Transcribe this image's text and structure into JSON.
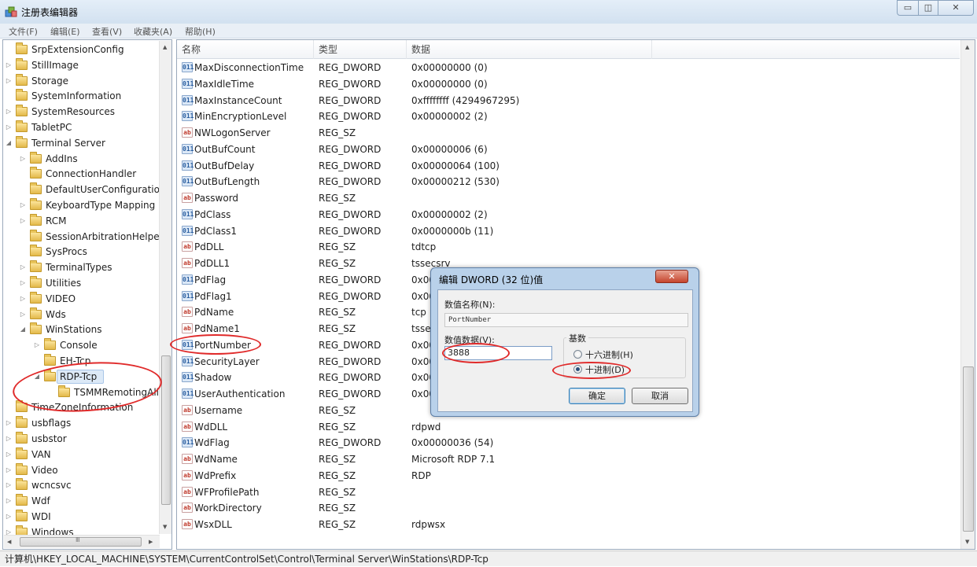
{
  "window": {
    "title": "注册表编辑器",
    "controls": {
      "minimize": "▭",
      "maximize": "◫",
      "close": "✕"
    }
  },
  "menu": [
    "文件(F)",
    "编辑(E)",
    "查看(V)",
    "收藏夹(A)",
    "帮助(H)"
  ],
  "tree": {
    "nodes": [
      {
        "label": "SrpExtensionConfig",
        "level": 0,
        "expander": "none"
      },
      {
        "label": "StillImage",
        "level": 0,
        "expander": "collapsed"
      },
      {
        "label": "Storage",
        "level": 0,
        "expander": "collapsed"
      },
      {
        "label": "SystemInformation",
        "level": 0,
        "expander": "none"
      },
      {
        "label": "SystemResources",
        "level": 0,
        "expander": "collapsed"
      },
      {
        "label": "TabletPC",
        "level": 0,
        "expander": "collapsed"
      },
      {
        "label": "Terminal Server",
        "level": 0,
        "expander": "expanded"
      },
      {
        "label": "AddIns",
        "level": 1,
        "expander": "collapsed"
      },
      {
        "label": "ConnectionHandler",
        "level": 1,
        "expander": "none"
      },
      {
        "label": "DefaultUserConfiguratior",
        "level": 1,
        "expander": "none"
      },
      {
        "label": "KeyboardType Mapping",
        "level": 1,
        "expander": "collapsed"
      },
      {
        "label": "RCM",
        "level": 1,
        "expander": "collapsed"
      },
      {
        "label": "SessionArbitrationHelper",
        "level": 1,
        "expander": "none"
      },
      {
        "label": "SysProcs",
        "level": 1,
        "expander": "none"
      },
      {
        "label": "TerminalTypes",
        "level": 1,
        "expander": "collapsed"
      },
      {
        "label": "Utilities",
        "level": 1,
        "expander": "collapsed"
      },
      {
        "label": "VIDEO",
        "level": 1,
        "expander": "collapsed"
      },
      {
        "label": "Wds",
        "level": 1,
        "expander": "collapsed"
      },
      {
        "label": "WinStations",
        "level": 1,
        "expander": "expanded"
      },
      {
        "label": "Console",
        "level": 2,
        "expander": "collapsed"
      },
      {
        "label": "EH-Tcp",
        "level": 2,
        "expander": "none"
      },
      {
        "label": "RDP-Tcp",
        "level": 2,
        "expander": "expanded",
        "selected": true
      },
      {
        "label": "TSMMRemotingAll",
        "level": 3,
        "expander": "none"
      },
      {
        "label": "TimeZoneInformation",
        "level": 0,
        "expander": "none"
      },
      {
        "label": "usbflags",
        "level": 0,
        "expander": "collapsed"
      },
      {
        "label": "usbstor",
        "level": 0,
        "expander": "collapsed"
      },
      {
        "label": "VAN",
        "level": 0,
        "expander": "collapsed"
      },
      {
        "label": "Video",
        "level": 0,
        "expander": "collapsed"
      },
      {
        "label": "wcncsvc",
        "level": 0,
        "expander": "collapsed"
      },
      {
        "label": "Wdf",
        "level": 0,
        "expander": "collapsed"
      },
      {
        "label": "WDI",
        "level": 0,
        "expander": "collapsed"
      },
      {
        "label": "Windows",
        "level": 0,
        "expander": "collapsed"
      }
    ],
    "hscroll_grip": "Ⅲ"
  },
  "list": {
    "headers": {
      "name": "名称",
      "type": "类型",
      "data": "数据"
    },
    "rows": [
      {
        "name": "MaxDisconnectionTime",
        "type": "REG_DWORD",
        "data": "0x00000000 (0)",
        "icon": "binary"
      },
      {
        "name": "MaxIdleTime",
        "type": "REG_DWORD",
        "data": "0x00000000 (0)",
        "icon": "binary"
      },
      {
        "name": "MaxInstanceCount",
        "type": "REG_DWORD",
        "data": "0xffffffff (4294967295)",
        "icon": "binary"
      },
      {
        "name": "MinEncryptionLevel",
        "type": "REG_DWORD",
        "data": "0x00000002 (2)",
        "icon": "binary"
      },
      {
        "name": "NWLogonServer",
        "type": "REG_SZ",
        "data": "",
        "icon": "string"
      },
      {
        "name": "OutBufCount",
        "type": "REG_DWORD",
        "data": "0x00000006 (6)",
        "icon": "binary"
      },
      {
        "name": "OutBufDelay",
        "type": "REG_DWORD",
        "data": "0x00000064 (100)",
        "icon": "binary"
      },
      {
        "name": "OutBufLength",
        "type": "REG_DWORD",
        "data": "0x00000212 (530)",
        "icon": "binary"
      },
      {
        "name": "Password",
        "type": "REG_SZ",
        "data": "",
        "icon": "string"
      },
      {
        "name": "PdClass",
        "type": "REG_DWORD",
        "data": "0x00000002 (2)",
        "icon": "binary"
      },
      {
        "name": "PdClass1",
        "type": "REG_DWORD",
        "data": "0x0000000b (11)",
        "icon": "binary"
      },
      {
        "name": "PdDLL",
        "type": "REG_SZ",
        "data": "tdtcp",
        "icon": "string"
      },
      {
        "name": "PdDLL1",
        "type": "REG_SZ",
        "data": "tssecsrv",
        "icon": "string"
      },
      {
        "name": "PdFlag",
        "type": "REG_DWORD",
        "data": "0x00",
        "icon": "binary"
      },
      {
        "name": "PdFlag1",
        "type": "REG_DWORD",
        "data": "0x00",
        "icon": "binary"
      },
      {
        "name": "PdName",
        "type": "REG_SZ",
        "data": "tcp",
        "icon": "string"
      },
      {
        "name": "PdName1",
        "type": "REG_SZ",
        "data": "tsse",
        "icon": "string"
      },
      {
        "name": "PortNumber",
        "type": "REG_DWORD",
        "data": "0x00",
        "icon": "binary"
      },
      {
        "name": "SecurityLayer",
        "type": "REG_DWORD",
        "data": "0x00",
        "icon": "binary"
      },
      {
        "name": "Shadow",
        "type": "REG_DWORD",
        "data": "0x00",
        "icon": "binary"
      },
      {
        "name": "UserAuthentication",
        "type": "REG_DWORD",
        "data": "0x00",
        "icon": "binary"
      },
      {
        "name": "Username",
        "type": "REG_SZ",
        "data": "",
        "icon": "string"
      },
      {
        "name": "WdDLL",
        "type": "REG_SZ",
        "data": "rdpwd",
        "icon": "string"
      },
      {
        "name": "WdFlag",
        "type": "REG_DWORD",
        "data": "0x00000036 (54)",
        "icon": "binary"
      },
      {
        "name": "WdName",
        "type": "REG_SZ",
        "data": "Microsoft RDP 7.1",
        "icon": "string"
      },
      {
        "name": "WdPrefix",
        "type": "REG_SZ",
        "data": "RDP",
        "icon": "string"
      },
      {
        "name": "WFProfilePath",
        "type": "REG_SZ",
        "data": "",
        "icon": "string"
      },
      {
        "name": "WorkDirectory",
        "type": "REG_SZ",
        "data": "",
        "icon": "string"
      },
      {
        "name": "WsxDLL",
        "type": "REG_SZ",
        "data": "rdpwsx",
        "icon": "string"
      }
    ],
    "icon_glyphs": {
      "binary": "011",
      "string": "ab"
    }
  },
  "dialog": {
    "title": "编辑 DWORD (32 位)值",
    "close": "✕",
    "name_label": "数值名称(N):",
    "name_value": "PortNumber",
    "data_label": "数值数据(V):",
    "data_value": "3888",
    "base_label": "基数",
    "radio_hex": "十六进制(H)",
    "radio_dec": "十进制(D)",
    "selected_base": "decimal",
    "ok": "确定",
    "cancel": "取消"
  },
  "statusbar": {
    "path": "计算机\\HKEY_LOCAL_MACHINE\\SYSTEM\\CurrentControlSet\\Control\\Terminal Server\\WinStations\\RDP-Tcp"
  },
  "annotation_color": "#e02a2a"
}
